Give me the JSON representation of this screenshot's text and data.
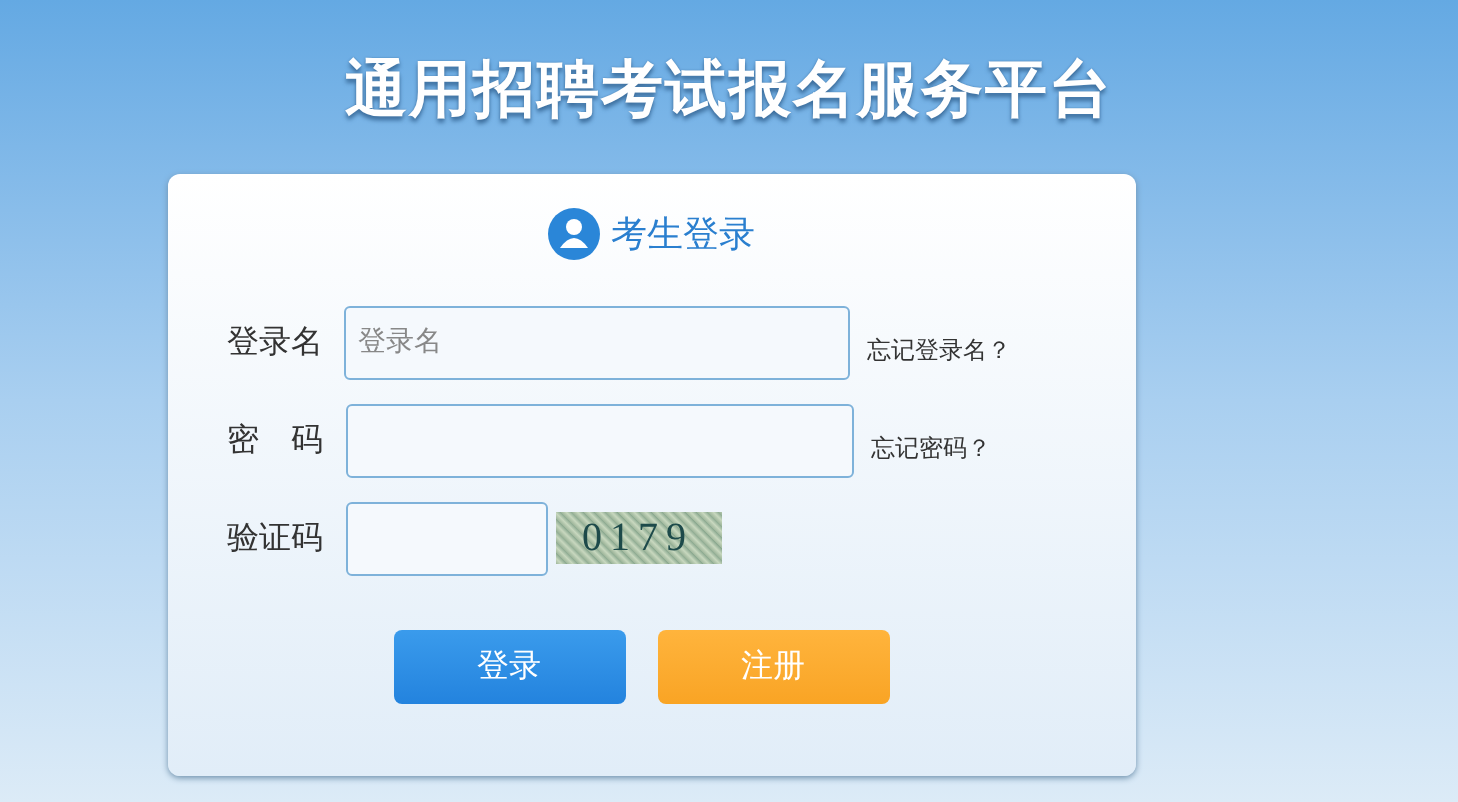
{
  "title": "通用招聘考试报名服务平台",
  "card": {
    "heading": "考生登录",
    "fields": [
      {
        "kind": "text",
        "label": "登录名",
        "placeholder": "登录名",
        "link": "忘记登录名？"
      },
      {
        "kind": "password",
        "label": "密　码",
        "link": "忘记密码？"
      },
      {
        "kind": "captcha",
        "label": "验证码",
        "captcha": "0179"
      }
    ],
    "buttons": [
      {
        "label": "登录",
        "kind": "primary"
      },
      {
        "label": "注册",
        "kind": "secondary"
      }
    ]
  }
}
